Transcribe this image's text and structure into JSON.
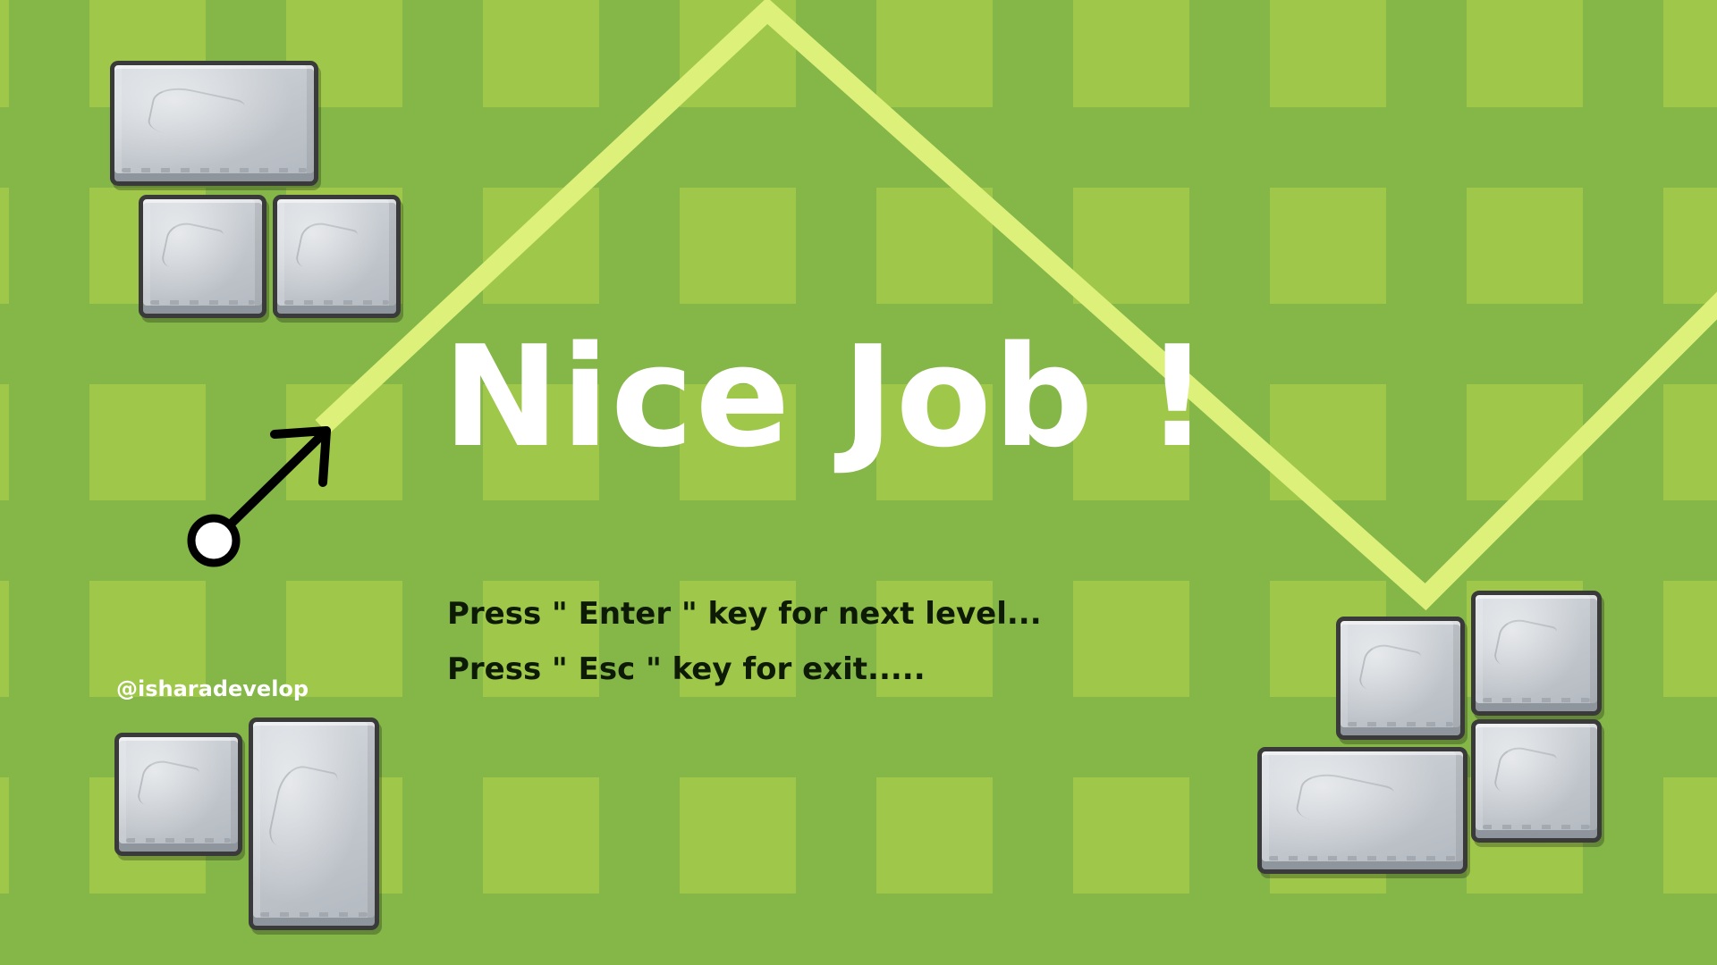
{
  "screen": {
    "title": "Nice Job !",
    "hints": [
      "Press \" Enter \" key for next level...",
      "Press \" Esc \" key for exit....."
    ],
    "watermark": "@isharadevelop"
  },
  "colors": {
    "background_light": "#9fc84a",
    "background_dark": "#84b648",
    "path_line": "#dcf07a",
    "title_text": "#ffffff",
    "hint_text": "#0d1a05",
    "stone": "#c4c9cf",
    "arrow": "#000000"
  },
  "icons": {
    "player_ball": "ball-icon",
    "aim_arrow": "arrow-icon"
  }
}
